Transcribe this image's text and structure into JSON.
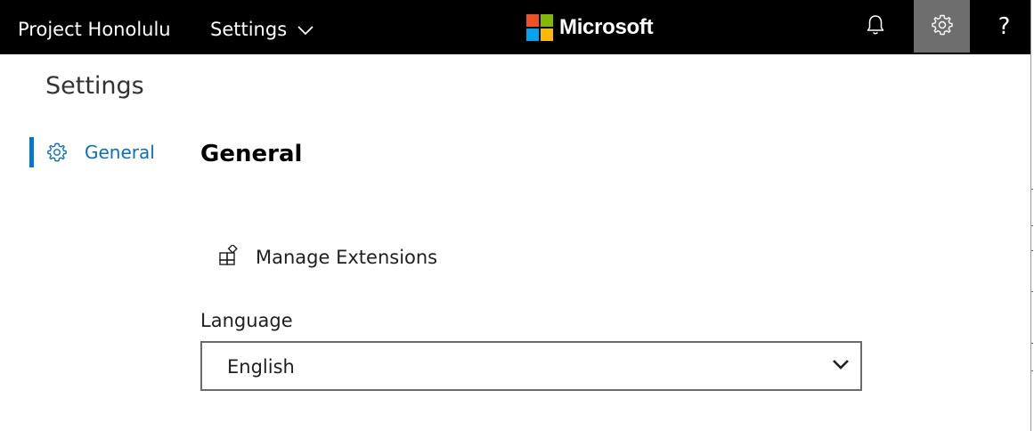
{
  "header": {
    "app_name": "Project Honolulu",
    "settings_menu_label": "Settings",
    "brand_name": "Microsoft",
    "brand_colors": [
      "#f25022",
      "#7fba00",
      "#00a4ef",
      "#ffb900"
    ],
    "notification_icon": "bell-icon",
    "settings_icon": "gear-icon",
    "help_glyph": "?"
  },
  "page": {
    "title": "Settings"
  },
  "sidebar": {
    "items": [
      {
        "label": "General",
        "icon": "gear-icon",
        "selected": true,
        "accent": "#0078d4"
      }
    ]
  },
  "general": {
    "title": "General",
    "manage_extensions_label": "Manage Extensions",
    "manage_extensions_icon": "extensions-icon",
    "language_label": "Language",
    "language_value": "English"
  }
}
